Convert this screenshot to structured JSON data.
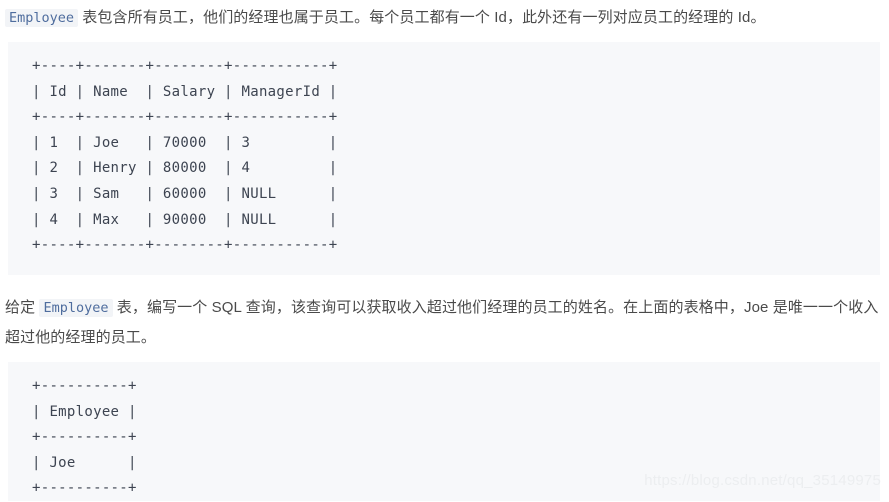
{
  "paragraphs": {
    "first": {
      "inline_code": "Employee",
      "text": " 表包含所有员工，他们的经理也属于员工。每个员工都有一个 Id，此外还有一列对应员工的经理的 Id。"
    },
    "second": {
      "prefix": "给定 ",
      "inline_code": "Employee",
      "text": " 表，编写一个 SQL 查询，该查询可以获取收入超过他们经理的员工的姓名。在上面的表格中，Joe 是唯一一个收入超过他的经理的员工。"
    }
  },
  "code_blocks": {
    "employee_table": {
      "lines": [
        "+----+-------+--------+-----------+",
        "| Id | Name  | Salary | ManagerId |",
        "+----+-------+--------+-----------+",
        "| 1  | Joe   | 70000  | 3         |",
        "| 2  | Henry | 80000  | 4         |",
        "| 3  | Sam   | 60000  | NULL      |",
        "| 4  | Max   | 90000  | NULL      |",
        "+----+-------+--------+-----------+"
      ],
      "columns": [
        "Id",
        "Name",
        "Salary",
        "ManagerId"
      ],
      "rows": [
        [
          "1",
          "Joe",
          "70000",
          "3"
        ],
        [
          "2",
          "Henry",
          "80000",
          "4"
        ],
        [
          "3",
          "Sam",
          "60000",
          "NULL"
        ],
        [
          "4",
          "Max",
          "90000",
          "NULL"
        ]
      ]
    },
    "result_table": {
      "lines": [
        "+----------+",
        "| Employee |",
        "+----------+",
        "| Joe      |",
        "+----------+"
      ],
      "columns": [
        "Employee"
      ],
      "rows": [
        [
          "Joe"
        ]
      ]
    }
  },
  "watermark": {
    "text": "https://blog.csdn.net/qq_35149975"
  },
  "colors": {
    "code_background": "#f7f8fa",
    "code_text": "#3d4451",
    "inline_code_text": "#4f6d9e",
    "inline_code_background": "#f2f4f7",
    "body_text": "#4a4a4a",
    "watermark": "#eceef0"
  }
}
